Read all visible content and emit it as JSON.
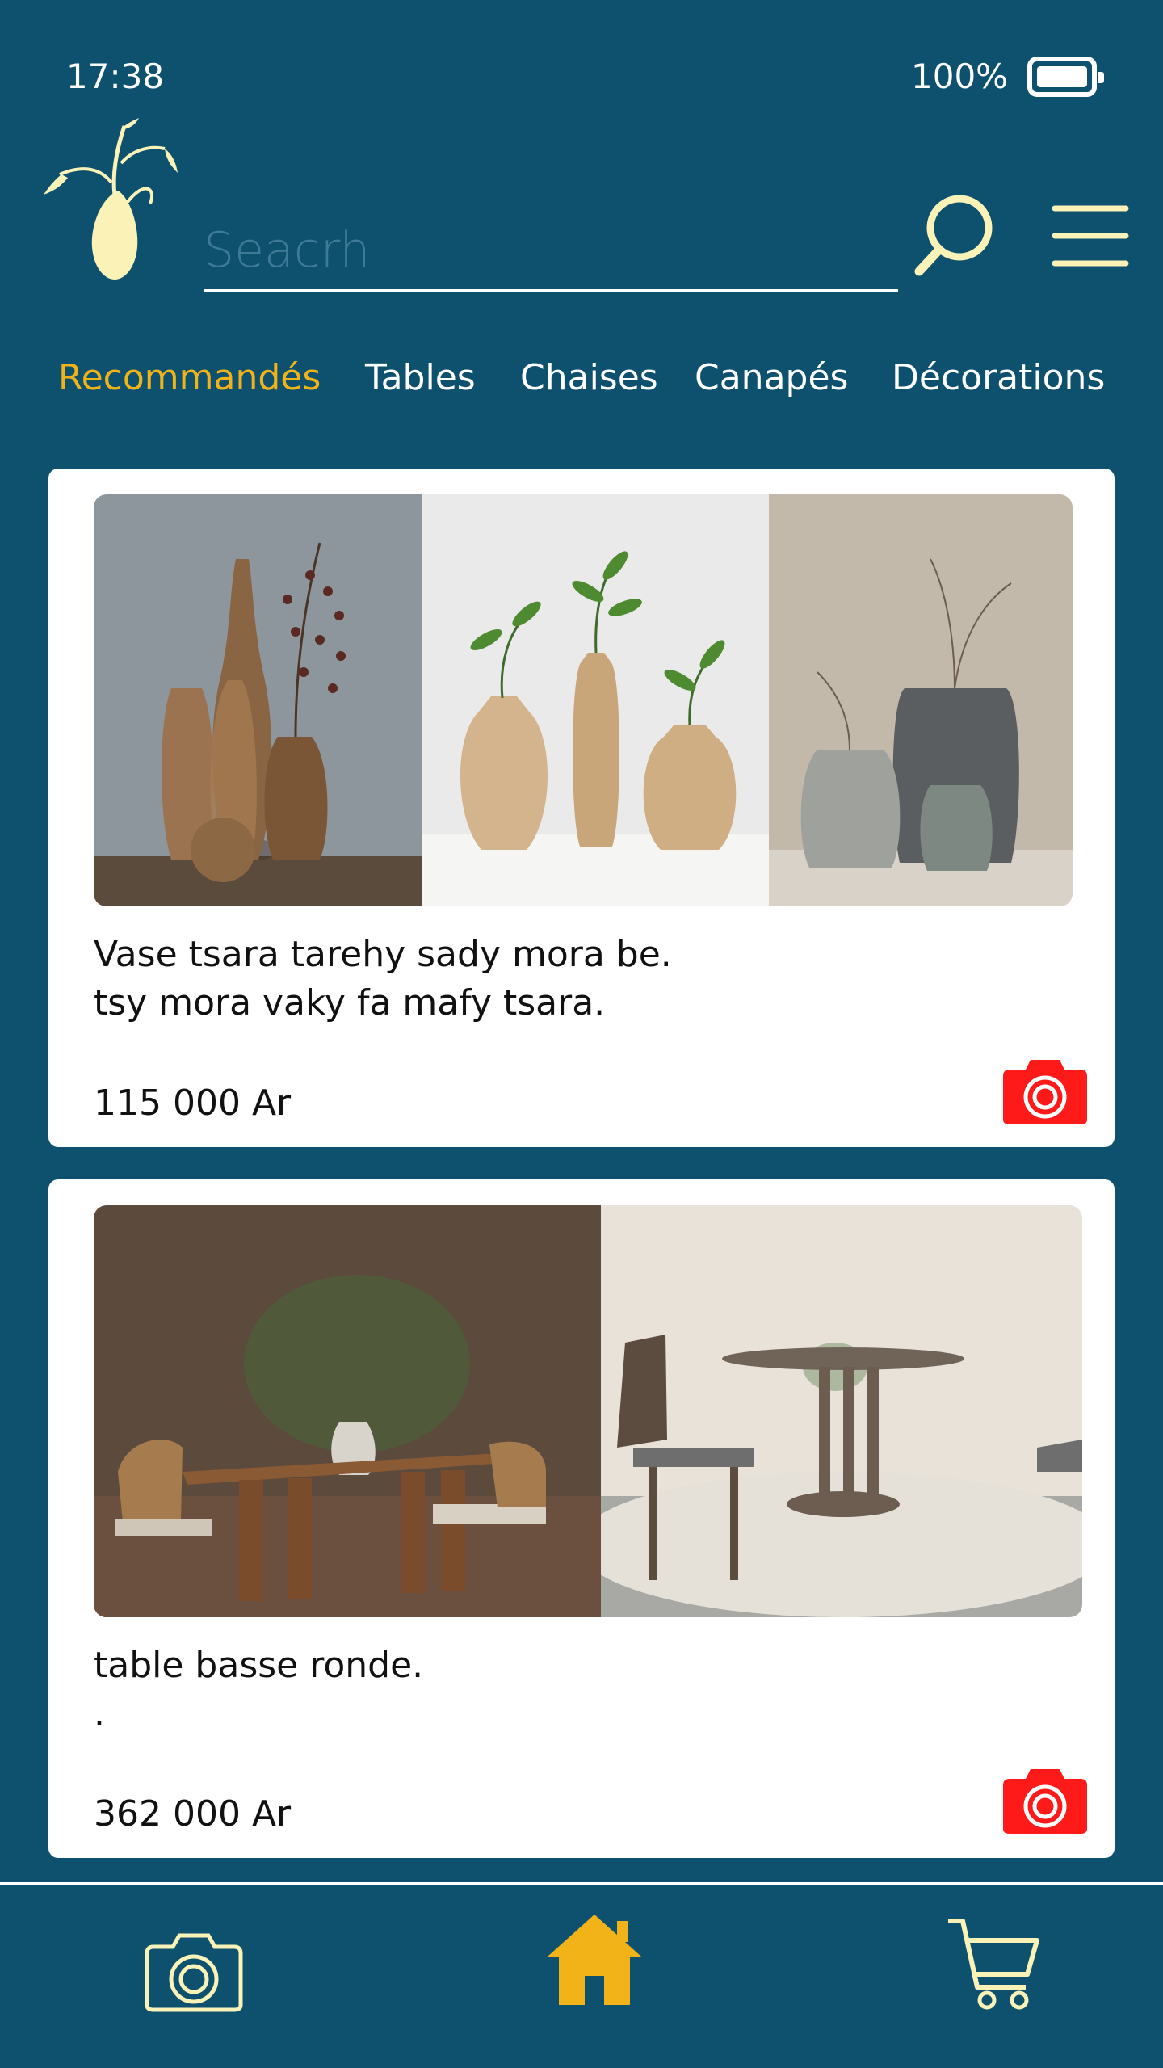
{
  "status_bar": {
    "time": "17:38",
    "battery": "100%"
  },
  "header": {
    "search": {
      "placeholder": "Seacrh",
      "value": ""
    }
  },
  "tabs": [
    {
      "label": "Recommandés",
      "active": true
    },
    {
      "label": "Tables",
      "active": false
    },
    {
      "label": "Chaises",
      "active": false
    },
    {
      "label": "Canapés",
      "active": false
    },
    {
      "label": "Décorations",
      "active": false
    }
  ],
  "products": [
    {
      "description_line1": "Vase tsara tarehy sady mora be.",
      "description_line2": "tsy mora vaky fa mafy tsara.",
      "price": "115 000 Ar",
      "icon": "camera-icon"
    },
    {
      "description_line1": "table basse ronde.",
      "description_line2": ".",
      "price": "362 000 Ar",
      "icon": "camera-icon"
    }
  ],
  "bottom_nav": {
    "items": [
      "camera-icon",
      "home-icon",
      "cart-icon"
    ]
  },
  "colors": {
    "background": "#0d516f",
    "accent": "#f2b319",
    "logo": "#fbf2b8",
    "camera_button": "#ff1a1a",
    "card": "#ffffff"
  }
}
